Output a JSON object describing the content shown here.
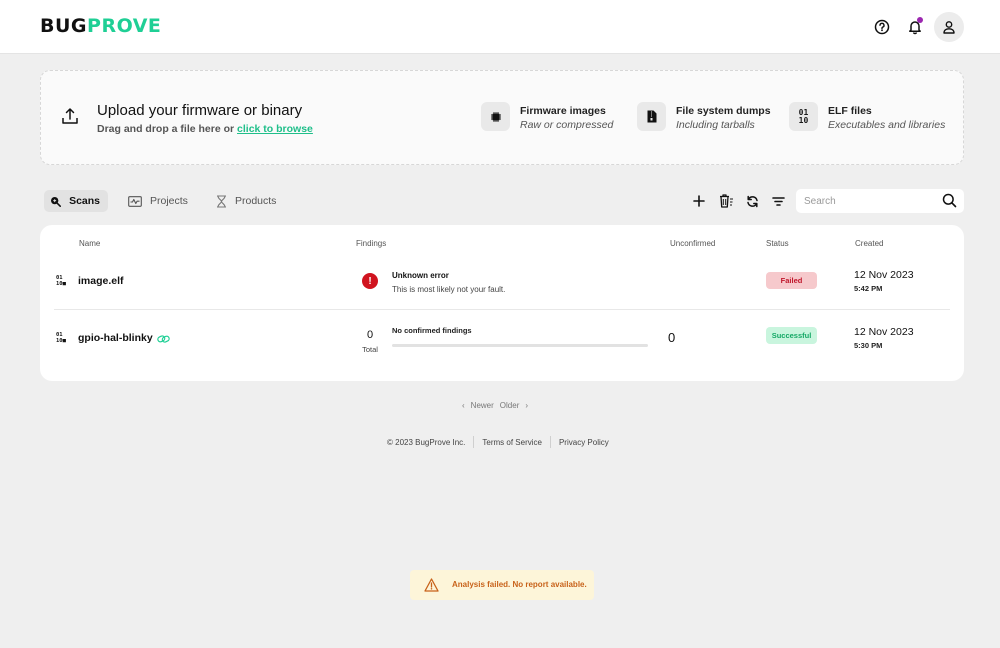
{
  "header": {
    "logo_part1": "BUG",
    "logo_part2": "PROVE",
    "brand_color": "#1fcf95",
    "icons": [
      "help-icon",
      "notification-bell-icon",
      "user-avatar-icon"
    ],
    "notification_dot_color": "#9c27b0"
  },
  "upload": {
    "title": "Upload your firmware or binary",
    "subtitle_prefix": "Drag and drop a file here or ",
    "browse_link": "click to browse",
    "file_types": [
      {
        "icon": "chip-icon",
        "title": "Firmware images",
        "subtitle": "Raw or compressed"
      },
      {
        "icon": "file-zip-icon",
        "title": "File system dumps",
        "subtitle": "Including tarballs"
      },
      {
        "icon": "binary-icon",
        "icon_text": "01\n10",
        "title": "ELF files",
        "subtitle": "Executables and libraries"
      }
    ]
  },
  "tabs": [
    {
      "label": "Scans",
      "icon": "scan-search-icon",
      "active": true
    },
    {
      "label": "Projects",
      "icon": "activity-icon",
      "active": false
    },
    {
      "label": "Products",
      "icon": "hourglass-icon",
      "active": false
    }
  ],
  "toolbar": {
    "actions": [
      "add-icon",
      "delete-list-icon",
      "refresh-icon",
      "filter-icon"
    ],
    "search_placeholder": "Search",
    "search_value": ""
  },
  "table": {
    "columns": {
      "name": "Name",
      "findings": "Findings",
      "unconfirmed": "Unconfirmed",
      "status": "Status",
      "created": "Created"
    },
    "rows": [
      {
        "name": "image.elf",
        "icon_text": "01\n10",
        "findings_error_title": "Unknown error",
        "findings_error_subtitle": "This is most likely not your fault.",
        "unconfirmed": "",
        "status": "Failed",
        "date": "12 Nov 2023",
        "time": "5:42 PM"
      },
      {
        "name": "gpio-hal-blinky",
        "icon_text": "01\n10",
        "linked": true,
        "findings_total": "0",
        "findings_total_label": "Total",
        "findings_summary": "No confirmed findings",
        "findings_progress": 0,
        "unconfirmed": "0",
        "status": "Successful",
        "date": "12 Nov 2023",
        "time": "5:30 PM"
      }
    ]
  },
  "pagination": {
    "newer": "Newer",
    "older": "Older"
  },
  "footer": {
    "copyright": "© 2023 BugProve Inc.",
    "terms": "Terms of Service",
    "privacy": "Privacy Policy"
  },
  "toast": {
    "message": "Analysis failed. No report available.",
    "color": "#c8621a"
  }
}
